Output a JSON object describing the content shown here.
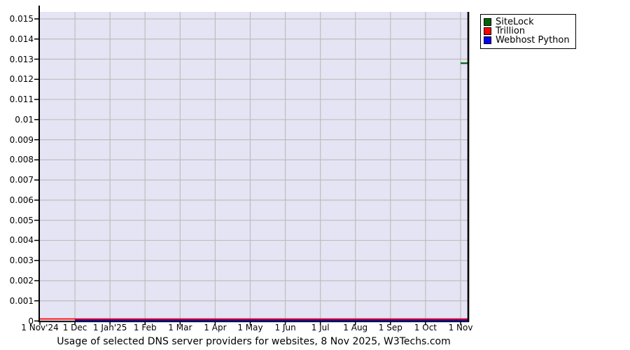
{
  "title": "Usage of selected DNS server providers for websites, 8 Nov 2025, W3Techs.com",
  "legend": {
    "items": [
      {
        "label": "SiteLock",
        "color": "#006400"
      },
      {
        "label": "Trillion",
        "color": "#ff0000"
      },
      {
        "label": "Webhost Python",
        "color": "#0000ff"
      }
    ]
  },
  "chart_data": {
    "type": "line",
    "title": "Usage of selected DNS server providers for websites, 8 Nov 2025, W3Techs.com",
    "xlabel": "",
    "ylabel": "",
    "x_tick_labels": [
      "1 Nov'24",
      "1 Dec",
      "1 Jan'25",
      "1 Feb",
      "1 Mar",
      "1 Apr",
      "1 May",
      "1 Jun",
      "1 Jul",
      "1 Aug",
      "1 Sep",
      "1 Oct",
      "1 Nov"
    ],
    "y_tick_labels": [
      "0",
      "0.001",
      "0.002",
      "0.003",
      "0.004",
      "0.005",
      "0.006",
      "0.007",
      "0.008",
      "0.009",
      "0.01",
      "0.011",
      "0.012",
      "0.013",
      "0.014",
      "0.015"
    ],
    "y_tick_values": [
      0,
      0.001,
      0.002,
      0.003,
      0.004,
      0.005,
      0.006,
      0.007,
      0.008,
      0.009,
      0.01,
      0.011,
      0.012,
      0.013,
      0.014,
      0.015
    ],
    "ylim": [
      0,
      0.015
    ],
    "grid": true,
    "legend_position": "top-right",
    "plot_background": "#e4e4f4",
    "gridline_color": "#bdbdbd",
    "axis_color": "#000000",
    "series": [
      {
        "name": "SiteLock",
        "color": "#006400",
        "values": [
          null,
          null,
          null,
          null,
          null,
          null,
          null,
          null,
          null,
          null,
          null,
          null,
          0.0128
        ]
      },
      {
        "name": "Trillion",
        "color": "#ff0000",
        "values": [
          0.0001,
          0.0001,
          0.0001,
          0.0001,
          0.0001,
          0.0001,
          0.0001,
          0.0001,
          0.0001,
          0.0001,
          0.0001,
          0.0001,
          0.0001
        ]
      },
      {
        "name": "Webhost Python",
        "color": "#0000ff",
        "values": [
          null,
          4e-05,
          4e-05,
          4e-05,
          4e-05,
          4e-05,
          4e-05,
          4e-05,
          4e-05,
          4e-05,
          4e-05,
          4e-05,
          4e-05
        ]
      }
    ]
  }
}
